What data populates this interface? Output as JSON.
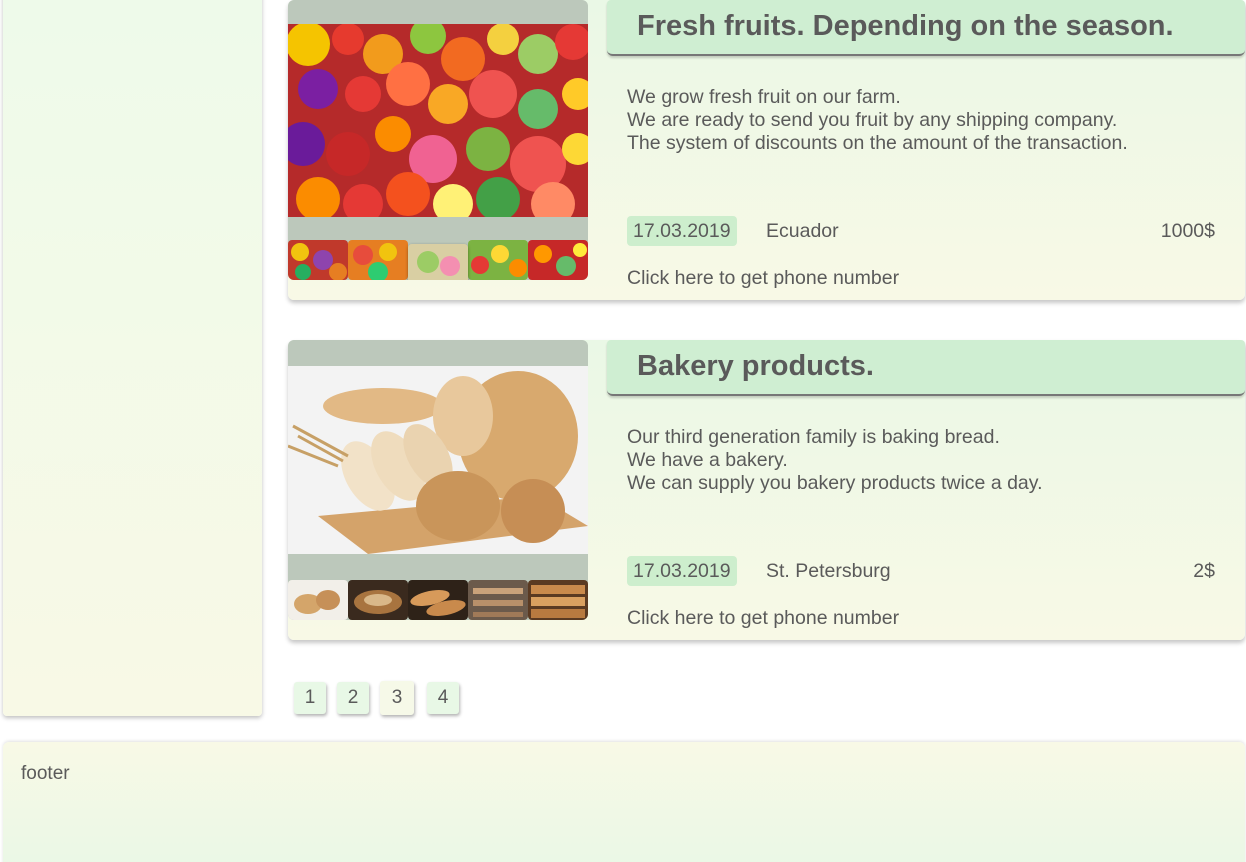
{
  "listings": [
    {
      "title": "Fresh fruits. Depending on the season.",
      "description": [
        "We grow fresh fruit on our farm.",
        "We are ready to send you fruit by any shipping company.",
        "The system of discounts on the amount of the transaction."
      ],
      "date": "17.03.2019",
      "location": "Ecuador",
      "price": "1000$",
      "phone_link": "Click here to get phone number"
    },
    {
      "title": "Bakery products.",
      "description": [
        "Our third generation family is baking bread.",
        "We have a bakery.",
        "We can supply you bakery products twice a day."
      ],
      "date": "17.03.2019",
      "location": "St. Petersburg",
      "price": "2$",
      "phone_link": "Click here to get phone number"
    }
  ],
  "pagination": {
    "pages": [
      "1",
      "2",
      "3",
      "4"
    ],
    "current": "3"
  },
  "footer": {
    "text": "footer"
  },
  "colors": {
    "title_bar": "#cfeed2",
    "date_badge": "#cdeecd",
    "gallery_bg": "#bcc8bb",
    "text": "#5a5a5a"
  }
}
